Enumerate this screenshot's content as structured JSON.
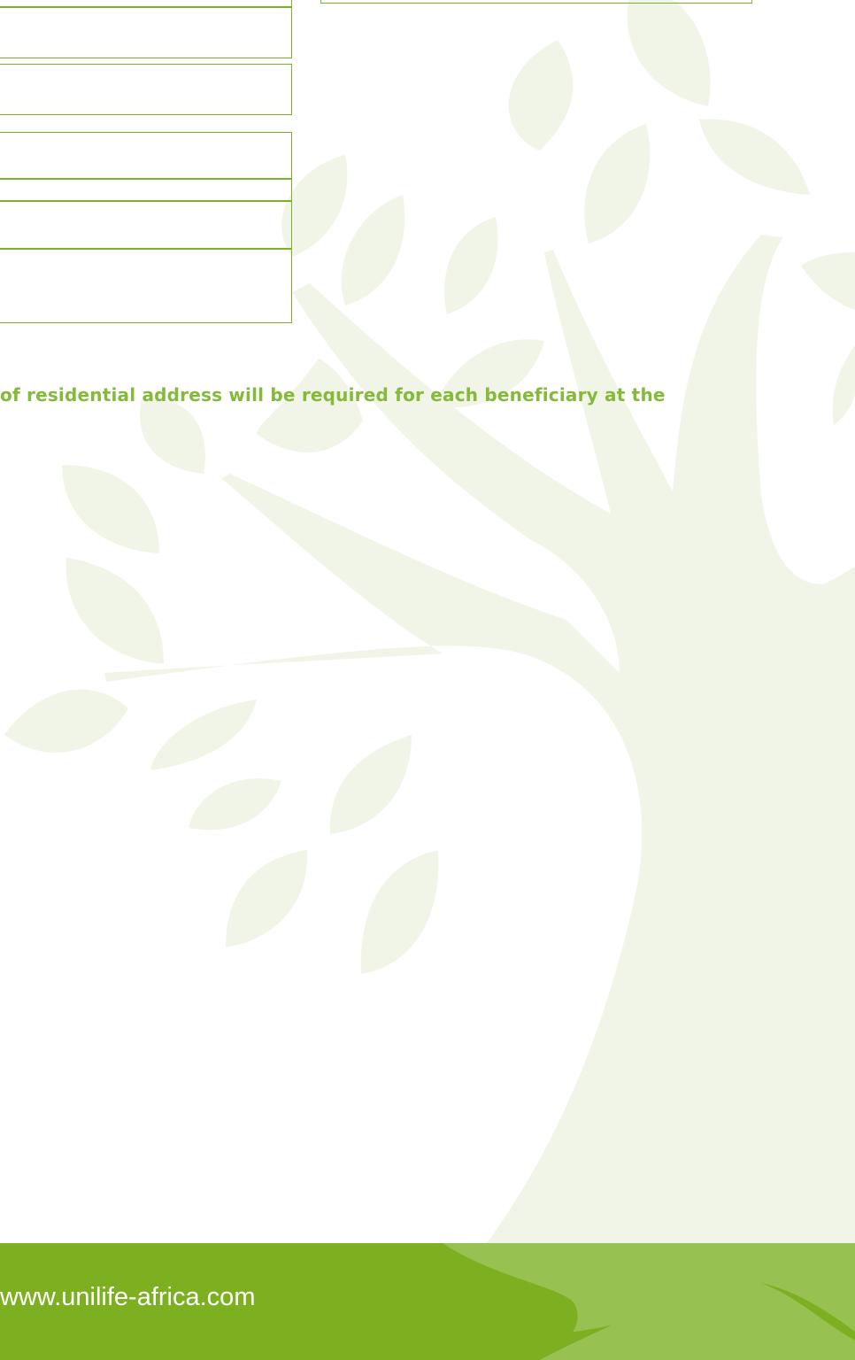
{
  "note": {
    "text": "of residential address will be required for each beneficiary at the"
  },
  "footer": {
    "url": "www.unilife-africa.com"
  },
  "colors": {
    "brand_green": "#7db021",
    "text_green": "#84b93a",
    "field_border": "#7ab02a",
    "tree_tint": "#f1f5e8"
  }
}
